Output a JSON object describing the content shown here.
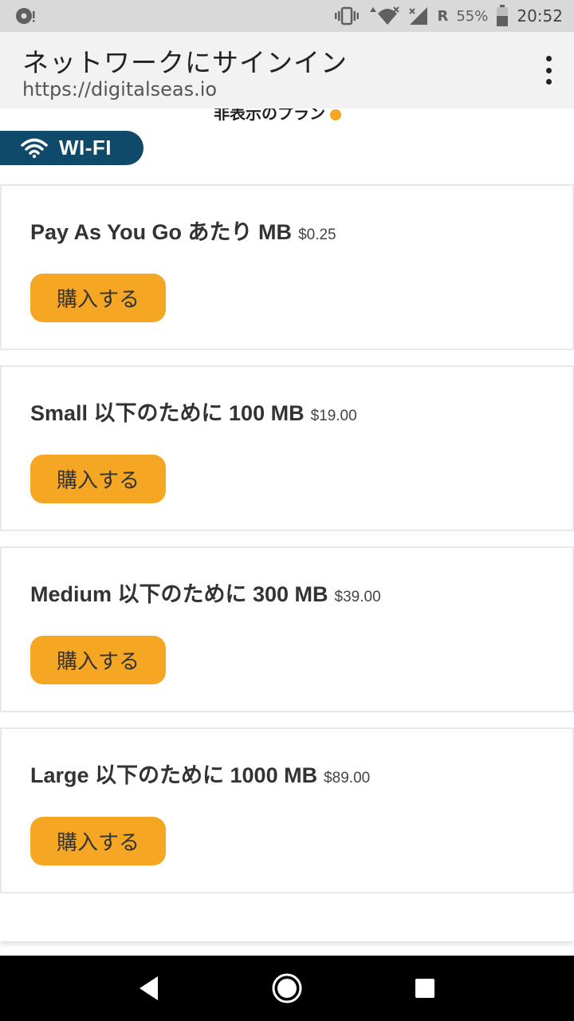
{
  "status_bar": {
    "time": "20:52",
    "battery_percent": "55%",
    "roaming_label": "R",
    "icons": [
      "notification-icon",
      "vibrate-icon",
      "wifi-icon",
      "signal-icon",
      "battery-icon"
    ]
  },
  "header": {
    "title": "ネットワークにサインイン",
    "url": "https://digitalseas.io",
    "menu_icon": "overflow-menu-icon"
  },
  "content": {
    "cutoff_text": "非表示のプラン",
    "tab": {
      "label": "WI-FI",
      "icon": "wifi-icon",
      "color": "#0f4a6b"
    },
    "accent_color": "#f5a623",
    "plans": [
      {
        "name": "Pay As You Go あたり MB",
        "price": "$0.25",
        "button_label": "購入する"
      },
      {
        "name": "Small 以下のために 100 MB",
        "price": "$19.00",
        "button_label": "購入する"
      },
      {
        "name": "Medium 以下のために 300 MB",
        "price": "$39.00",
        "button_label": "購入する"
      },
      {
        "name": "Large 以下のために 1000 MB",
        "price": "$89.00",
        "button_label": "購入する"
      }
    ]
  },
  "nav_bar": {
    "buttons": [
      "back-icon",
      "home-icon",
      "recents-icon"
    ]
  }
}
